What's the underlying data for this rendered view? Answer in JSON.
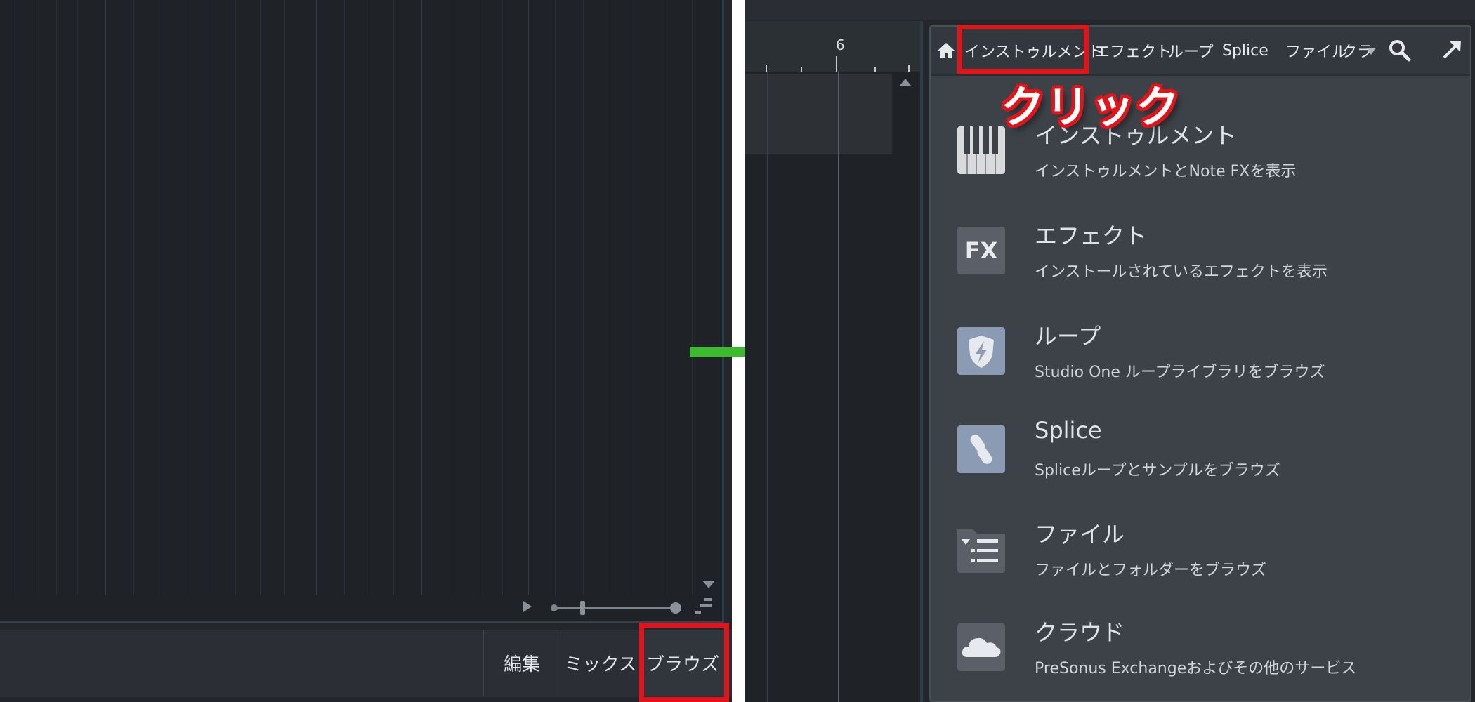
{
  "left_panel": {
    "bottom_bar": {
      "edit_label": "編集",
      "mix_label": "ミックス",
      "browse_label": "ブラウズ"
    }
  },
  "right_panel": {
    "ruler_number": "6",
    "browser": {
      "tabs": [
        {
          "label": "インストゥルメント"
        },
        {
          "label": "エフェクト"
        },
        {
          "label": "ループ"
        },
        {
          "label": "Splice"
        },
        {
          "label": "ファイル"
        },
        {
          "label": "クラ"
        }
      ],
      "categories": [
        {
          "icon": "piano-keys-icon",
          "title": "インストゥルメント",
          "description": "インストゥルメントとNote FXを表示"
        },
        {
          "icon": "fx-icon",
          "title": "エフェクト",
          "description": "インストールされているエフェクトを表示"
        },
        {
          "icon": "loop-shield-icon",
          "title": "ループ",
          "description": "Studio One ループライブラリをブラウズ"
        },
        {
          "icon": "splice-icon",
          "title": "Splice",
          "description": "Spliceループとサンプルをブラウズ"
        },
        {
          "icon": "folder-icon",
          "title": "ファイル",
          "description": "ファイルとフォルダーをブラウズ"
        },
        {
          "icon": "cloud-icon",
          "title": "クラウド",
          "description": "PreSonus Exchangeおよびその他のサービス"
        }
      ],
      "fx_icon_text": "FX"
    }
  },
  "annotation": {
    "click_label": "クリック",
    "highlight_color": "#e1141c",
    "arrow_color": "#3dbb2f"
  }
}
